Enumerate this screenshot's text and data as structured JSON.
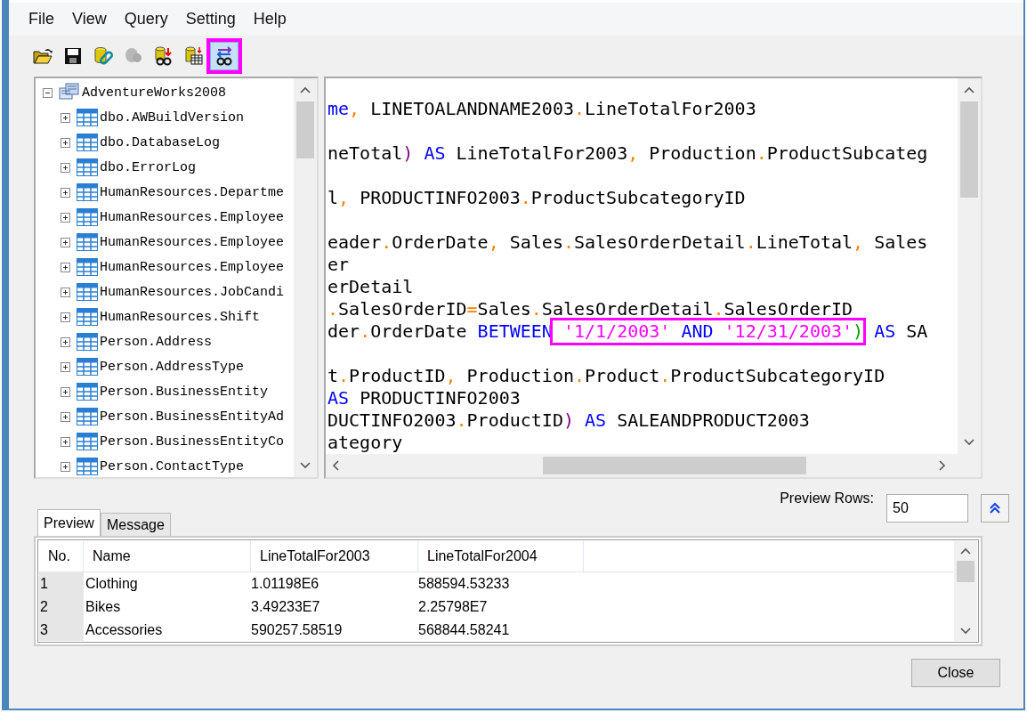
{
  "menu": [
    "File",
    "View",
    "Query",
    "Setting",
    "Help"
  ],
  "toolbar": [
    {
      "disabled": false,
      "selected": false,
      "annotated": false
    },
    {
      "disabled": false,
      "selected": false,
      "annotated": false
    },
    {
      "disabled": false,
      "selected": false,
      "annotated": false
    },
    {
      "disabled": true,
      "selected": false,
      "annotated": false
    },
    {
      "disabled": false,
      "selected": false,
      "annotated": false
    },
    {
      "disabled": false,
      "selected": false,
      "annotated": false
    },
    {
      "disabled": false,
      "selected": true,
      "annotated": true
    }
  ],
  "tree": {
    "label": "AdventureWorks2008",
    "expanded": true,
    "children": [
      {
        "label": "dbo.AWBuildVersion",
        "expanded": false
      },
      {
        "label": "dbo.DatabaseLog",
        "expanded": false
      },
      {
        "label": "dbo.ErrorLog",
        "expanded": false
      },
      {
        "label": "HumanResources.Departme",
        "expanded": false
      },
      {
        "label": "HumanResources.Employee",
        "expanded": false
      },
      {
        "label": "HumanResources.Employee",
        "expanded": false
      },
      {
        "label": "HumanResources.Employee",
        "expanded": false
      },
      {
        "label": "HumanResources.JobCandi",
        "expanded": false
      },
      {
        "label": "HumanResources.Shift",
        "expanded": false
      },
      {
        "label": "Person.Address",
        "expanded": false
      },
      {
        "label": "Person.AddressType",
        "expanded": false
      },
      {
        "label": "Person.BusinessEntity",
        "expanded": false
      },
      {
        "label": "Person.BusinessEntityAd",
        "expanded": false
      },
      {
        "label": "Person.BusinessEntityCo",
        "expanded": false
      },
      {
        "label": "Person.ContactType",
        "expanded": false
      }
    ]
  },
  "editor": {
    "lines": [
      {
        "gap_before": false,
        "parts": [
          {
            "boxed": false,
            "tokens": [
              {
                "kind": "keyword",
                "t": "me"
              },
              {
                "kind": "symbol",
                "t": ","
              },
              {
                "kind": "plain",
                "t": " LINETOALANDNAME2003"
              },
              {
                "kind": "symbol",
                "t": "."
              },
              {
                "kind": "plain",
                "t": "LineTotalFor2003"
              }
            ]
          }
        ]
      },
      {
        "gap_before": true,
        "parts": [
          {
            "boxed": false,
            "tokens": [
              {
                "kind": "plain",
                "t": "neTotal"
              },
              {
                "kind": "paren",
                "t": ")"
              },
              {
                "kind": "keyword",
                "t": " AS"
              },
              {
                "kind": "plain",
                "t": " LineTotalFor2003"
              },
              {
                "kind": "symbol",
                "t": ","
              },
              {
                "kind": "plain",
                "t": " Production"
              },
              {
                "kind": "symbol",
                "t": "."
              },
              {
                "kind": "plain",
                "t": "ProductSubcateg"
              }
            ]
          }
        ]
      },
      {
        "gap_before": true,
        "parts": [
          {
            "boxed": false,
            "tokens": [
              {
                "kind": "plain",
                "t": "l"
              },
              {
                "kind": "symbol",
                "t": ","
              },
              {
                "kind": "plain",
                "t": " PRODUCTINFO2003"
              },
              {
                "kind": "symbol",
                "t": "."
              },
              {
                "kind": "plain",
                "t": "ProductSubcategoryID"
              }
            ]
          }
        ]
      },
      {
        "gap_before": true,
        "parts": [
          {
            "boxed": false,
            "tokens": [
              {
                "kind": "plain",
                "t": "eader"
              },
              {
                "kind": "symbol",
                "t": "."
              },
              {
                "kind": "plain",
                "t": "OrderDate"
              },
              {
                "kind": "symbol",
                "t": ","
              },
              {
                "kind": "plain",
                "t": " Sales"
              },
              {
                "kind": "symbol",
                "t": "."
              },
              {
                "kind": "plain",
                "t": "SalesOrderDetail"
              },
              {
                "kind": "symbol",
                "t": "."
              },
              {
                "kind": "plain",
                "t": "LineTotal"
              },
              {
                "kind": "symbol",
                "t": ","
              },
              {
                "kind": "plain",
                "t": " Sales"
              }
            ]
          }
        ]
      },
      {
        "gap_before": false,
        "parts": [
          {
            "boxed": false,
            "tokens": [
              {
                "kind": "plain",
                "t": "er"
              }
            ]
          }
        ]
      },
      {
        "gap_before": false,
        "parts": [
          {
            "boxed": false,
            "tokens": [
              {
                "kind": "plain",
                "t": "erDetail"
              }
            ]
          }
        ]
      },
      {
        "gap_before": false,
        "parts": [
          {
            "boxed": false,
            "tokens": [
              {
                "kind": "symbol",
                "t": "."
              },
              {
                "kind": "plain",
                "t": "SalesOrderID"
              },
              {
                "kind": "symbol",
                "t": "="
              },
              {
                "kind": "plain",
                "t": "Sales"
              },
              {
                "kind": "symbol",
                "t": "."
              },
              {
                "kind": "plain",
                "t": "SalesOrderDetail"
              },
              {
                "kind": "symbol",
                "t": "."
              },
              {
                "kind": "plain",
                "t": "SalesOrderID"
              }
            ]
          }
        ]
      },
      {
        "gap_before": false,
        "parts": [
          {
            "boxed": false,
            "tokens": [
              {
                "kind": "plain",
                "t": "der"
              },
              {
                "kind": "symbol",
                "t": "."
              },
              {
                "kind": "plain",
                "t": "OrderDate "
              },
              {
                "kind": "keyword",
                "t": "BETWEEN"
              }
            ]
          },
          {
            "boxed": true,
            "tokens": [
              {
                "kind": "string",
                "t": " '1/1/2003'"
              },
              {
                "kind": "keyword",
                "t": " AND"
              },
              {
                "kind": "string",
                "t": " '12/31/2003'"
              },
              {
                "kind": "bracket",
                "t": ")"
              }
            ]
          },
          {
            "boxed": false,
            "tokens": [
              {
                "kind": "keyword",
                "t": " AS"
              },
              {
                "kind": "plain",
                "t": " SA"
              }
            ]
          }
        ]
      },
      {
        "gap_before": true,
        "parts": [
          {
            "boxed": false,
            "tokens": [
              {
                "kind": "plain",
                "t": "t"
              },
              {
                "kind": "symbol",
                "t": "."
              },
              {
                "kind": "plain",
                "t": "ProductID"
              },
              {
                "kind": "symbol",
                "t": ","
              },
              {
                "kind": "plain",
                "t": " Production"
              },
              {
                "kind": "symbol",
                "t": "."
              },
              {
                "kind": "plain",
                "t": "Product"
              },
              {
                "kind": "symbol",
                "t": "."
              },
              {
                "kind": "plain",
                "t": "ProductSubcategoryID"
              }
            ]
          }
        ]
      },
      {
        "gap_before": false,
        "parts": [
          {
            "boxed": false,
            "tokens": [
              {
                "kind": "keyword",
                "t": "AS"
              },
              {
                "kind": "plain",
                "t": " PRODUCTINFO2003"
              }
            ]
          }
        ]
      },
      {
        "gap_before": false,
        "parts": [
          {
            "boxed": false,
            "tokens": [
              {
                "kind": "plain",
                "t": "DUCTINFO2003"
              },
              {
                "kind": "symbol",
                "t": "."
              },
              {
                "kind": "plain",
                "t": "ProductID"
              },
              {
                "kind": "paren",
                "t": ")"
              },
              {
                "kind": "keyword",
                "t": " AS"
              },
              {
                "kind": "plain",
                "t": " SALEANDPRODUCT2003"
              }
            ]
          }
        ]
      },
      {
        "gap_before": false,
        "parts": [
          {
            "boxed": false,
            "tokens": [
              {
                "kind": "plain",
                "t": "ategory"
              }
            ]
          }
        ]
      }
    ]
  },
  "preview_rows": {
    "label": "Preview Rows:",
    "value": "50"
  },
  "tabs": [
    {
      "label": "Preview",
      "selected": true
    },
    {
      "label": "Message",
      "selected": false
    }
  ],
  "table": {
    "columns": [
      "No.",
      "Name",
      "LineTotalFor2003",
      "LineTotalFor2004"
    ],
    "rows": [
      [
        "1",
        "Clothing",
        "1.01198E6",
        "588594.53233"
      ],
      [
        "2",
        "Bikes",
        "3.49233E7",
        "2.25798E7"
      ],
      [
        "3",
        "Accessories",
        "590257.58519",
        "568844.58241"
      ]
    ]
  },
  "close_button": "Close"
}
